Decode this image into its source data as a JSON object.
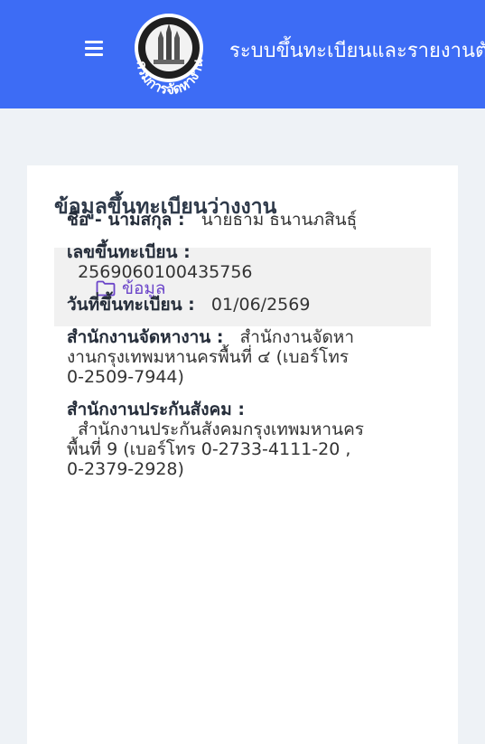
{
  "header": {
    "title": "ระบบขึ้นทะเบียนและรายงานตัว",
    "logo_text": "กรมการจัดหางาน"
  },
  "page": {
    "title": "ข้อมูลขึ้นทะเบียนว่างงาน",
    "tab_label": "ข้อมูล"
  },
  "info": {
    "name_label": "ชื่อ - นามสกุล :",
    "name_value": "นายธาม ธนานภสินธุ์",
    "regno_label": "เลขขึ้นทะเบียน :",
    "regno_value": "2569060100435756",
    "regdate_label": "วันที่ขึ้นทะเบียน :",
    "regdate_value": "01/06/2569",
    "office_label": "สำนักงานจัดหางาน :",
    "office_value": "สำนักงานจัดหางานกรุงเทพมหานครพื้นที่ ๔ (เบอร์โทร 0-2509-7944)",
    "sso_label": "สำนักงานประกันสังคม :",
    "sso_value": "สำนักงานประกันสังคมกรุงเทพมหานครพื้นที่ 9 (เบอร์โทร 0-2733-4111-20 , 0-2379-2928)"
  }
}
